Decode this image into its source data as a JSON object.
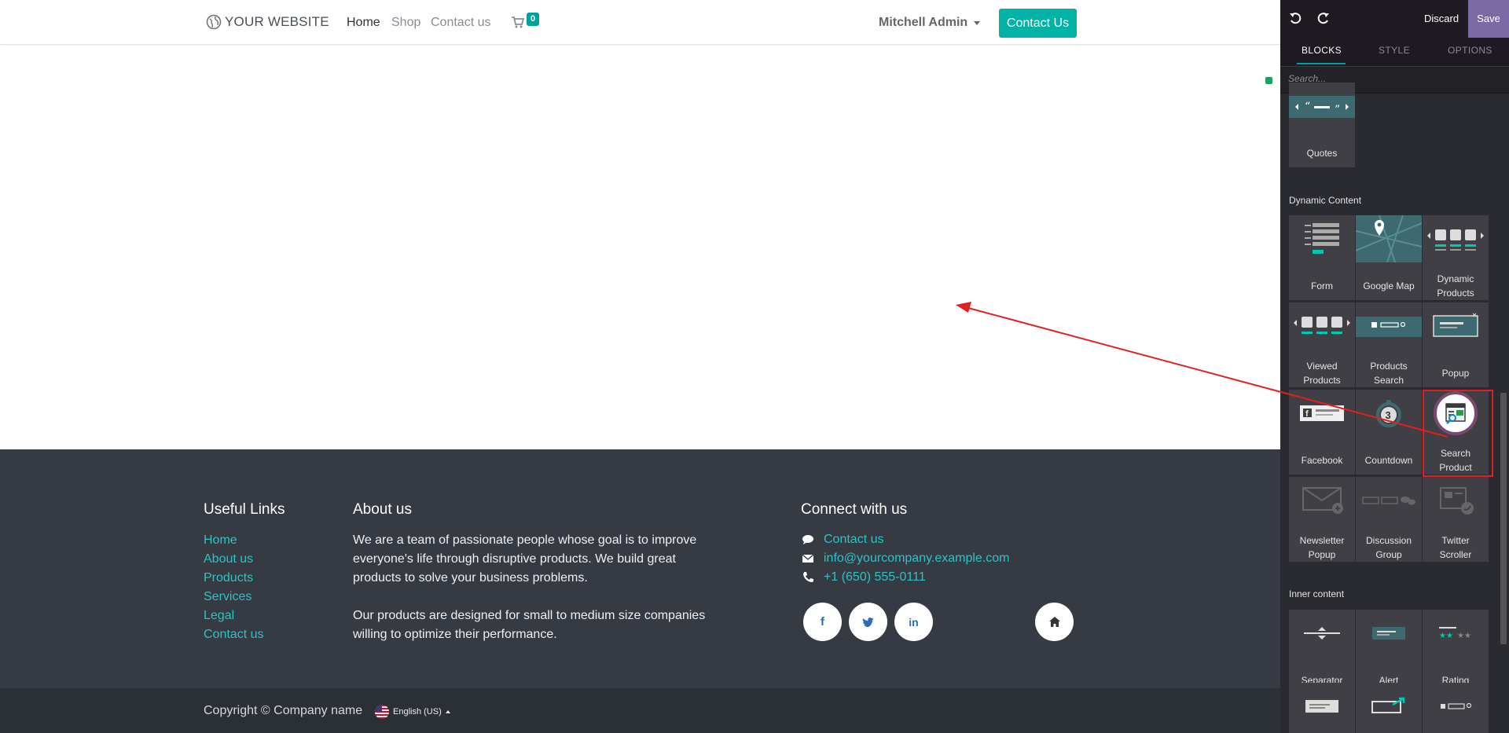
{
  "navbar": {
    "brand": "YOUR WEBSITE",
    "links": [
      "Home",
      "Shop",
      "Contact us"
    ],
    "cart_count": "0",
    "user": "Mitchell Admin",
    "cta": "Contact Us"
  },
  "footer": {
    "useful_links_title": "Useful Links",
    "useful_links": [
      "Home",
      "About us",
      "Products",
      "Services",
      "Legal",
      "Contact us"
    ],
    "about_title": "About us",
    "about_p1": "We are a team of passionate people whose goal is to improve everyone's life through disruptive products. We build great products to solve your business problems.",
    "about_p2": "Our products are designed for small to medium size companies willing to optimize their performance.",
    "connect_title": "Connect with us",
    "connect_items": [
      "Contact us",
      "info@yourcompany.example.com",
      "+1 (650) 555-0111"
    ],
    "copyright": "Copyright © Company name",
    "language": "English (US)"
  },
  "editor": {
    "discard": "Discard",
    "save": "Save",
    "tabs": [
      "BLOCKS",
      "STYLE",
      "OPTIONS"
    ],
    "search_placeholder": "Search...",
    "quotes_label": "Quotes",
    "dynamic_title": "Dynamic Content",
    "dynamic_blocks": [
      {
        "l1": "Form",
        "l2": ""
      },
      {
        "l1": "Google Map",
        "l2": ""
      },
      {
        "l1": "Dynamic",
        "l2": "Products"
      },
      {
        "l1": "Viewed",
        "l2": "Products"
      },
      {
        "l1": "Products",
        "l2": "Search"
      },
      {
        "l1": "Popup",
        "l2": ""
      },
      {
        "l1": "Facebook",
        "l2": ""
      },
      {
        "l1": "Countdown",
        "l2": ""
      },
      {
        "l1": "Search",
        "l2": "Product"
      },
      {
        "l1": "Newsletter",
        "l2": "Popup"
      },
      {
        "l1": "Discussion",
        "l2": "Group"
      },
      {
        "l1": "Twitter",
        "l2": "Scroller"
      }
    ],
    "inner_title": "Inner content",
    "inner_blocks": [
      "Separator",
      "Alert",
      "Rating"
    ]
  },
  "colors": {
    "accent": "#00a09d",
    "footer_bg": "#363a43",
    "editor_bg": "#2a2b31",
    "save_bg": "#7c6aa6",
    "annotation": "#e02020"
  }
}
